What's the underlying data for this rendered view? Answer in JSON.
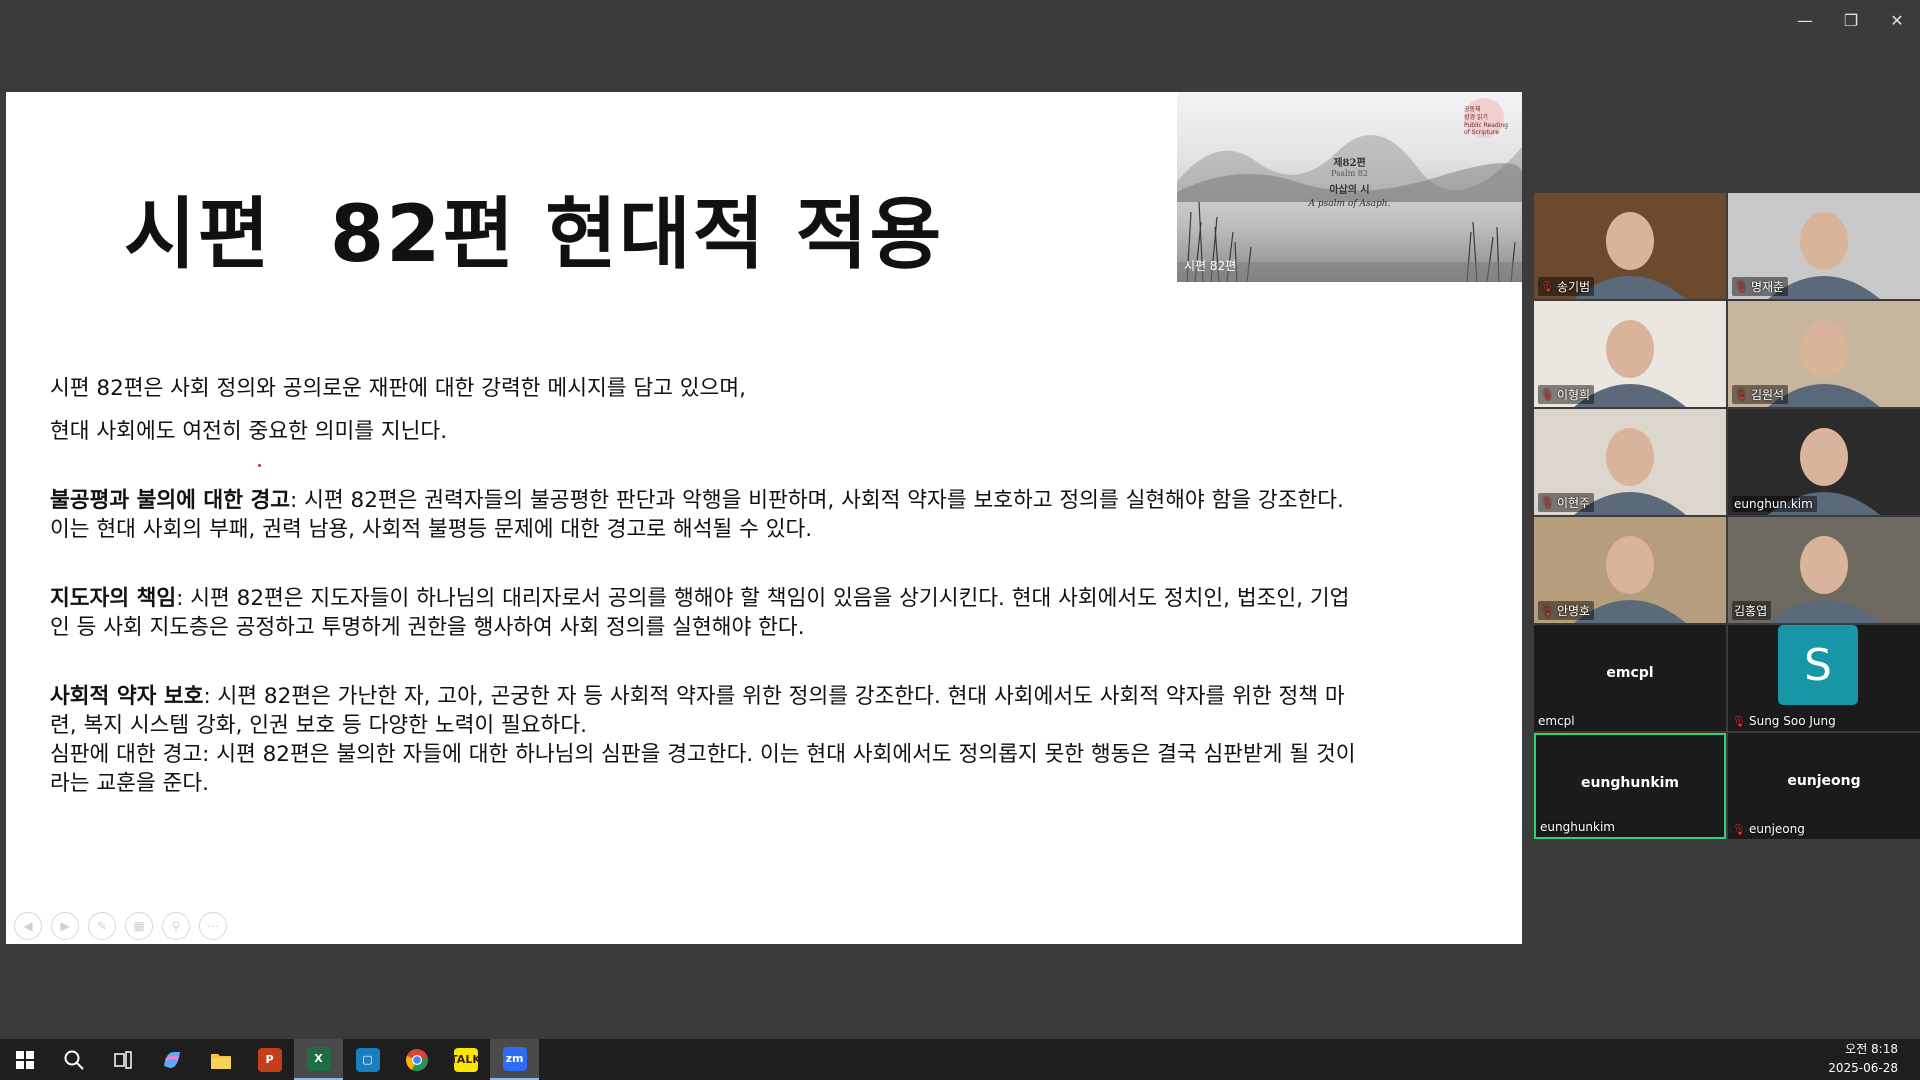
{
  "window": {
    "controls": {
      "minimize": "—",
      "restore": "❐",
      "close": "✕"
    }
  },
  "slide": {
    "title": "시편  82편 현대적 적용",
    "thumbnail": {
      "logo_text": [
        "공동체",
        "성경 읽기",
        "Public Reading",
        "of Scripture"
      ],
      "line1": "제82편",
      "line2": "Psalm 82",
      "line3": "아삽의 시",
      "line4": "A psalm of Asaph.",
      "caption": "시편 82편"
    },
    "paragraphs": [
      {
        "text": "시편 82편은 사회 정의와 공의로운 재판에 대한 강력한 메시지를 담고 있으며,"
      },
      {
        "text": "현대 사회에도 여전히 중요한 의미를 지닌다."
      },
      {
        "bold": "불공평과 불의에 대한 경고",
        "text": ": 시편 82편은 권력자들의 불공평한 판단과 악행을 비판하며, 사회적 약자를 보호하고 정의를 실현해야 함을 강조한다. 이는 현대 사회의 부패, 권력 남용, 사회적 불평등 문제에 대한 경고로 해석될 수 있다."
      },
      {
        "bold": "지도자의 책임",
        "text": ": 시편 82편은 지도자들이 하나님의 대리자로서 공의를 행해야 할 책임이 있음을 상기시킨다. 현대 사회에서도 정치인, 법조인, 기업인 등 사회 지도층은 공정하고 투명하게 권한을 행사하여 사회 정의를 실현해야 한다."
      },
      {
        "bold": "사회적 약자 보호",
        "text": ": 시편 82편은 가난한 자, 고아, 곤궁한 자 등 사회적 약자를 위한 정의를 강조한다. 현대 사회에서도 사회적 약자를 위한 정책 마련, 복지 시스템 강화, 인권 보호 등 다양한 노력이 필요하다."
      },
      {
        "text": "심판에 대한 경고: 시편 82편은 불의한 자들에 대한 하나님의 심판을 경고한다. 이는 현대 사회에서도 정의롭지 못한 행동은 결국 심판받게 될 것이라는 교훈을 준다."
      }
    ]
  },
  "participants": [
    {
      "name": "송기범",
      "muted": true,
      "bg": "#6b4a2f"
    },
    {
      "name": "명재춘",
      "muted": true,
      "bg": "#c9c9c9"
    },
    {
      "name": "이형희",
      "muted": true,
      "bg": "#ebe6df"
    },
    {
      "name": "김원석",
      "muted": true,
      "bg": "#c7b69d"
    },
    {
      "name": "이현주",
      "muted": true,
      "bg": "#dcd6cc"
    },
    {
      "name": "eunghun.kim",
      "muted": false,
      "bg": "#2b2b2b"
    },
    {
      "name": "안명호",
      "muted": true,
      "bg": "#b69e7c"
    },
    {
      "name": "김홍엽",
      "muted": false,
      "bg": "#6e6a62"
    },
    {
      "name": "emcpl",
      "display": "emcpl",
      "muted": false,
      "bg": "#1b1b1b"
    },
    {
      "name": "Sung Soo Jung",
      "avatar_letter": "S",
      "muted": true,
      "bg": "#1b1b1b"
    },
    {
      "name": "eunghunkim",
      "display": "eunghunkim",
      "muted": false,
      "bg": "#1b1b1b",
      "active": true
    },
    {
      "name": "eunjeong",
      "display": "eunjeong",
      "muted": true,
      "bg": "#1b1b1b"
    }
  ],
  "taskbar": {
    "apps": [
      {
        "icon": "windows-start-icon"
      },
      {
        "icon": "search-icon"
      },
      {
        "icon": "task-view-icon"
      },
      {
        "icon": "copilot-icon"
      },
      {
        "icon": "file-explorer-icon"
      },
      {
        "icon": "powerpoint-icon",
        "label": "P",
        "color": "#c43e1c"
      },
      {
        "icon": "excel-icon",
        "label": "X",
        "color": "#1d6f42",
        "active": true
      },
      {
        "icon": "store-icon",
        "color": "#1a7fc1"
      },
      {
        "icon": "chrome-icon"
      },
      {
        "icon": "kakaotalk-icon",
        "label": "TALK",
        "color": "#f7e600"
      },
      {
        "icon": "zoom-icon",
        "label": "zm",
        "color": "#2d6cf5",
        "active": true
      }
    ],
    "time": "오전 8:18",
    "date": "2025-06-28"
  }
}
